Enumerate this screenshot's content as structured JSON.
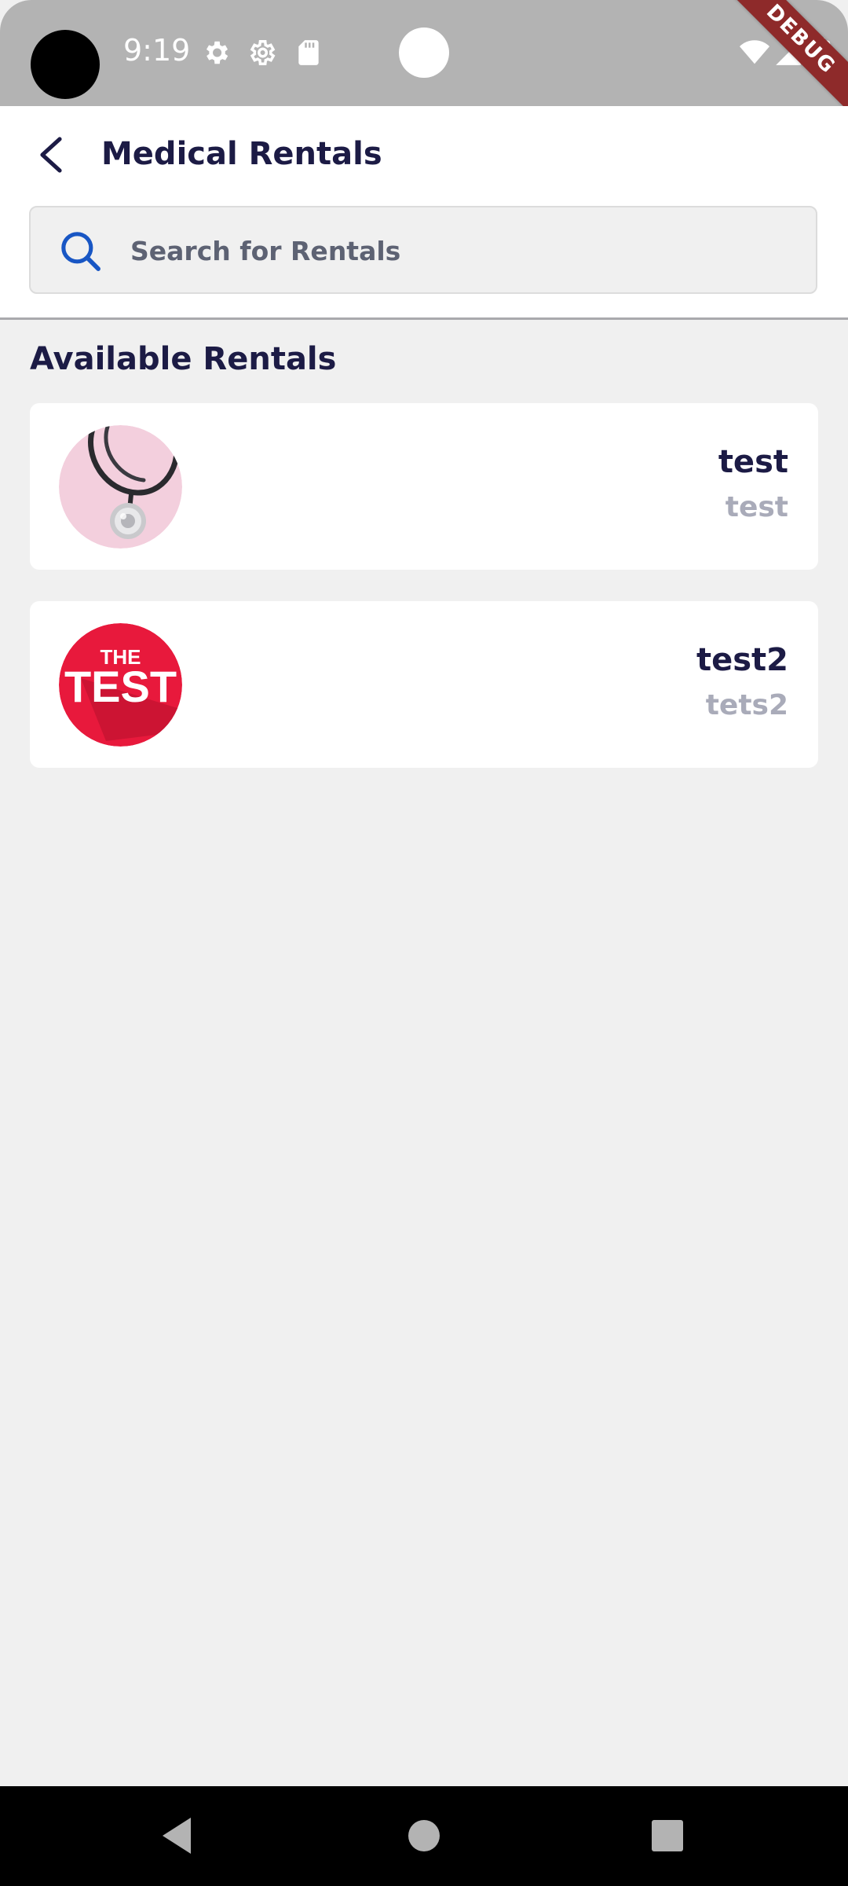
{
  "status_bar": {
    "time": "9:19",
    "debug_label": "DEBUG",
    "background": "#b3b3b3"
  },
  "app_bar": {
    "title": "Medical Rentals",
    "search_placeholder": "Search for Rentals",
    "search_value": "",
    "accent": "#1856c4"
  },
  "content": {
    "section_title": "Available Rentals",
    "rentals": [
      {
        "name": "test",
        "description": "test",
        "image": "stethoscope-image"
      },
      {
        "name": "test2",
        "description": "tets2",
        "image": "the-test-logo"
      }
    ]
  },
  "logo": {
    "line1": "THE",
    "line2": "TEST",
    "color": "#e8193c"
  },
  "colors": {
    "title": "#1c1b45",
    "subtitle": "#a9abb9",
    "background": "#f0f0f0"
  }
}
